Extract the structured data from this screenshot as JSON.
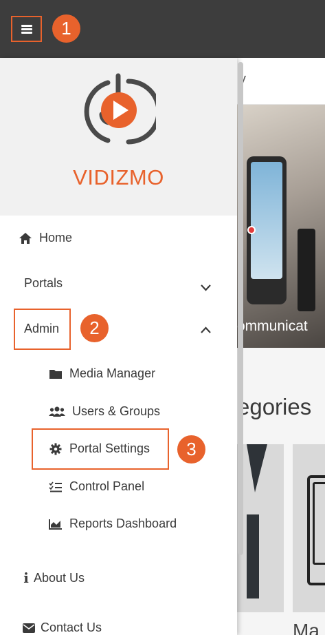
{
  "topbar": {
    "menu_icon": "hamburger-icon",
    "callout_1": "1"
  },
  "background": {
    "breadcrumb_partial": "y",
    "hero_caption_partial": "ommunicat",
    "categories_partial": "egories",
    "card_text_partial": "Ma"
  },
  "drawer": {
    "brand": "VIDIZMO",
    "logo_icon": "vidizmo-play-logo",
    "items": [
      {
        "label": "Home",
        "icon": "home-icon"
      },
      {
        "label": "Portals",
        "chevron": "chevron-down-icon"
      },
      {
        "label": "Admin",
        "chevron": "chevron-up-icon"
      }
    ],
    "admin_submenu": [
      {
        "label": "Media Manager",
        "icon": "folder-icon"
      },
      {
        "label": "Users & Groups",
        "icon": "users-icon"
      },
      {
        "label": "Portal Settings",
        "icon": "gear-icon"
      },
      {
        "label": "Control Panel",
        "icon": "checklist-icon"
      },
      {
        "label": "Reports Dashboard",
        "icon": "chart-icon"
      }
    ],
    "footer_items": [
      {
        "label": "About Us",
        "icon": "info-icon"
      },
      {
        "label": "Contact Us",
        "icon": "envelope-icon"
      }
    ],
    "callout_2": "2",
    "callout_3": "3"
  },
  "colors": {
    "accent": "#e8622c",
    "topbar": "#3d3d3d",
    "text": "#3a3a3a"
  }
}
